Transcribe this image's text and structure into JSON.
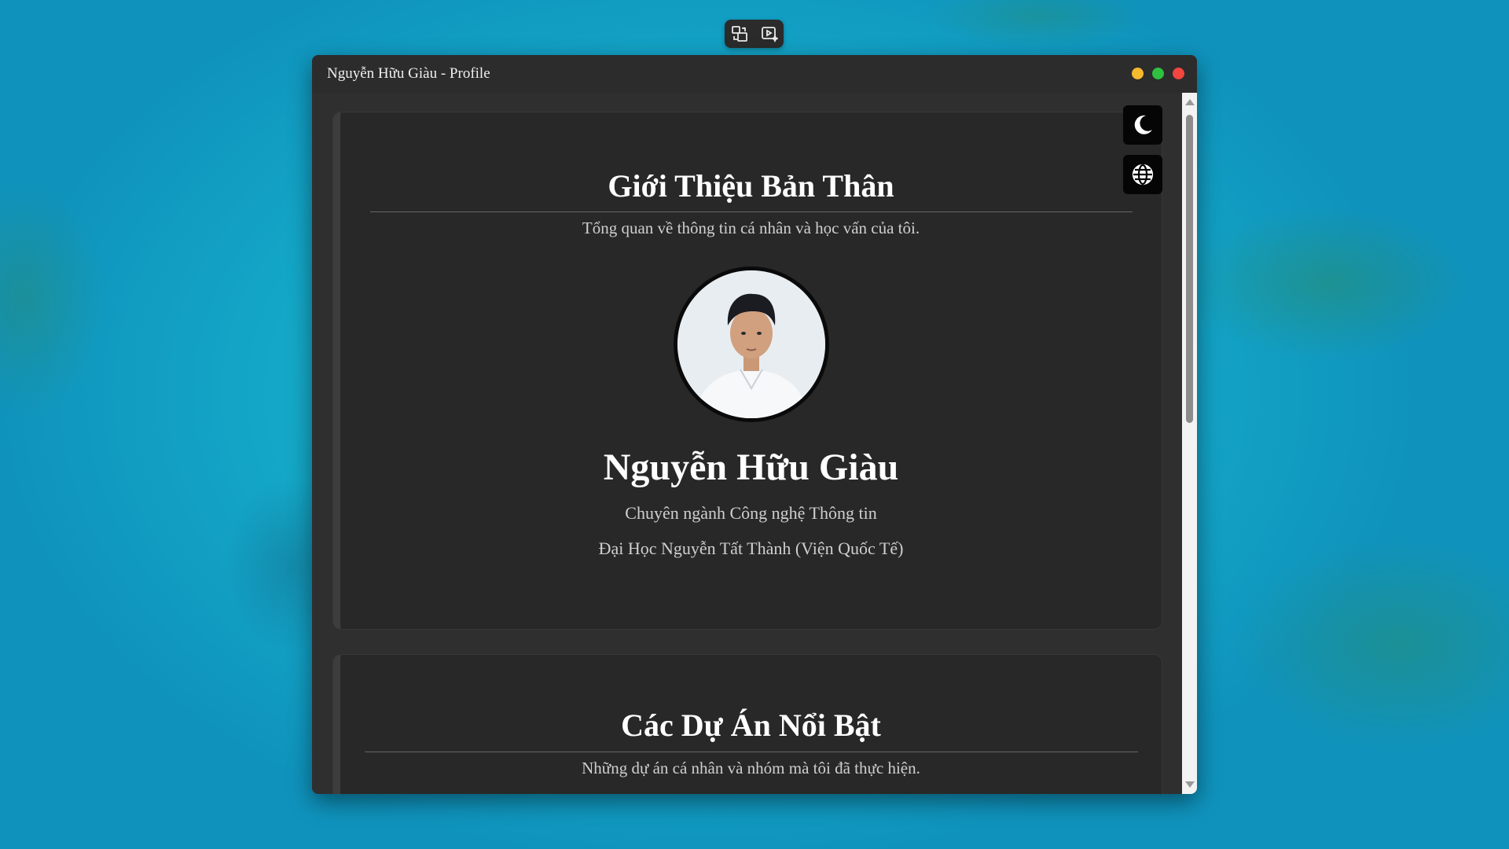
{
  "window": {
    "title": "Nguyễn Hữu Giàu - Profile"
  },
  "traffic_lights": {
    "minimize": "#f5b82e",
    "maximize": "#2fc140",
    "close": "#f2463f"
  },
  "capture_toolbar": {
    "icons": [
      "screen-switch-icon",
      "screen-record-icon"
    ]
  },
  "side_controls": {
    "icons": [
      "moon-icon",
      "globe-icon"
    ]
  },
  "about": {
    "heading": "Giới Thiệu Bản Thân",
    "subtitle": "Tổng quan về thông tin cá nhân và học vấn của tôi.",
    "name": "Nguyễn Hữu Giàu",
    "major": "Chuyên ngành Công nghệ Thông tin",
    "school": "Đại Học Nguyễn Tất Thành (Viện Quốc Tế)"
  },
  "projects": {
    "heading": "Các Dự Án Nổi Bật",
    "subtitle": "Những dự án cá nhân và nhóm mà tôi đã thực hiện."
  },
  "colors": {
    "window_bg": "#2f2f2f",
    "card_bg": "#282828",
    "card_accent": "#3d3d3d",
    "text_primary": "#ffffff",
    "text_secondary": "#cfcfcf"
  }
}
